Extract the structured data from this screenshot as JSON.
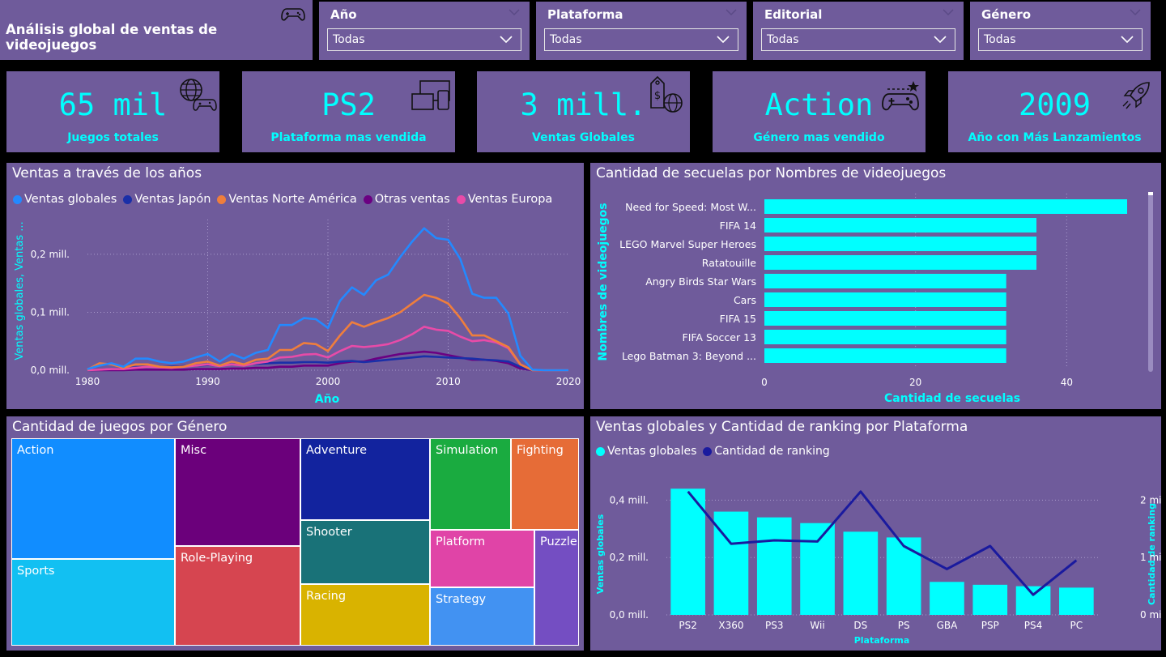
{
  "header": {
    "title": "Análisis global de ventas de videojuegos"
  },
  "slicers": [
    {
      "label": "Año",
      "value": "Todas"
    },
    {
      "label": "Plataforma",
      "value": "Todas"
    },
    {
      "label": "Editorial",
      "value": "Todas"
    },
    {
      "label": "Género",
      "value": "Todas"
    }
  ],
  "kpis": [
    {
      "value": "65 mil",
      "caption": "Juegos totales",
      "icon": "globe-gamepad-icon"
    },
    {
      "value": "PS2",
      "caption": "Plataforma mas vendida",
      "icon": "devices-icon"
    },
    {
      "value": "3 mill.",
      "caption": "Ventas Globales",
      "icon": "price-tag-globe-icon"
    },
    {
      "value": "Action",
      "caption": "Género mas vendido",
      "icon": "gamepad-star-icon"
    },
    {
      "value": "2009",
      "caption": "Año con Más Lanzamientos",
      "icon": "rocket-icon"
    }
  ],
  "colors": {
    "panel": "#6f5b9b",
    "accent": "#00ffff",
    "background": "#000000"
  },
  "chart_data": [
    {
      "type": "line",
      "title": "Ventas a través de los años",
      "xlabel": "Año",
      "ylabel": "Ventas globales, Ventas ...",
      "xlim": [
        1980,
        2020
      ],
      "ylim": [
        0,
        0.26
      ],
      "xticks": [
        "1980",
        "1990",
        "2000",
        "2010",
        "2020"
      ],
      "yticks": [
        {
          "v": 0,
          "label": "0,0 mill."
        },
        {
          "v": 0.1,
          "label": "0,1 mill."
        },
        {
          "v": 0.2,
          "label": "0,2 mill."
        }
      ],
      "x": [
        1980,
        1981,
        1982,
        1983,
        1984,
        1985,
        1986,
        1987,
        1988,
        1989,
        1990,
        1991,
        1992,
        1993,
        1994,
        1995,
        1996,
        1997,
        1998,
        1999,
        2000,
        2001,
        2002,
        2003,
        2004,
        2005,
        2006,
        2007,
        2008,
        2009,
        2010,
        2011,
        2012,
        2013,
        2014,
        2015,
        2016,
        2017,
        2018,
        2019,
        2020
      ],
      "series": [
        {
          "name": "Ventas globales",
          "color": "#2389ff",
          "values": [
            0.002,
            0.008,
            0.012,
            0.006,
            0.02,
            0.02,
            0.015,
            0.012,
            0.015,
            0.022,
            0.028,
            0.015,
            0.028,
            0.02,
            0.03,
            0.035,
            0.078,
            0.078,
            0.09,
            0.088,
            0.073,
            0.12,
            0.143,
            0.13,
            0.155,
            0.165,
            0.195,
            0.222,
            0.245,
            0.228,
            0.225,
            0.192,
            0.132,
            0.125,
            0.125,
            0.098,
            0.025,
            0.001,
            0,
            0,
            0
          ]
        },
        {
          "name": "Ventas Japón",
          "color": "#1a2fa8",
          "values": [
            0,
            0.001,
            0.002,
            0.003,
            0.005,
            0.006,
            0.006,
            0.006,
            0.007,
            0.008,
            0.009,
            0.008,
            0.01,
            0.01,
            0.011,
            0.012,
            0.013,
            0.013,
            0.014,
            0.014,
            0.013,
            0.015,
            0.016,
            0.014,
            0.016,
            0.018,
            0.02,
            0.022,
            0.024,
            0.023,
            0.022,
            0.021,
            0.02,
            0.018,
            0.017,
            0.015,
            0.006,
            0,
            0,
            0,
            0
          ]
        },
        {
          "name": "Ventas Norte América",
          "color": "#ef7e3c",
          "values": [
            0.001,
            0.012,
            0.01,
            0.004,
            0.01,
            0.01,
            0.006,
            0.005,
            0.006,
            0.012,
            0.015,
            0.008,
            0.015,
            0.01,
            0.018,
            0.02,
            0.035,
            0.035,
            0.047,
            0.045,
            0.033,
            0.06,
            0.083,
            0.075,
            0.083,
            0.09,
            0.1,
            0.115,
            0.13,
            0.125,
            0.115,
            0.09,
            0.06,
            0.06,
            0.05,
            0.04,
            0.01,
            0,
            0,
            0,
            0
          ]
        },
        {
          "name": "Otras ventas",
          "color": "#6b0082",
          "values": [
            0,
            0,
            0,
            0,
            0.001,
            0.001,
            0.001,
            0.001,
            0.001,
            0.002,
            0.002,
            0.002,
            0.003,
            0.003,
            0.004,
            0.004,
            0.006,
            0.006,
            0.008,
            0.008,
            0.008,
            0.012,
            0.015,
            0.015,
            0.02,
            0.024,
            0.028,
            0.03,
            0.032,
            0.03,
            0.026,
            0.022,
            0.018,
            0.018,
            0.016,
            0.012,
            0.003,
            0,
            0,
            0,
            0
          ]
        },
        {
          "name": "Ventas Europa",
          "color": "#e84ba8",
          "values": [
            0,
            0.001,
            0.002,
            0.002,
            0.004,
            0.006,
            0.005,
            0.004,
            0.006,
            0.008,
            0.01,
            0.007,
            0.01,
            0.008,
            0.012,
            0.015,
            0.022,
            0.023,
            0.027,
            0.028,
            0.022,
            0.033,
            0.042,
            0.04,
            0.042,
            0.045,
            0.052,
            0.062,
            0.075,
            0.07,
            0.068,
            0.058,
            0.05,
            0.052,
            0.048,
            0.038,
            0.01,
            0,
            0,
            0,
            0
          ]
        }
      ]
    },
    {
      "type": "bar",
      "orientation": "horizontal",
      "title": "Cantidad de secuelas por Nombres de videojuegos",
      "xlabel": "Cantidad de secuelas",
      "ylabel": "Nombres de videojuegos",
      "xlim": [
        0,
        48
      ],
      "xticks": [
        "0",
        "20",
        "40"
      ],
      "categories": [
        "Need for Speed: Most W...",
        "FIFA 14",
        "LEGO Marvel Super Heroes",
        "Ratatouille",
        "Angry Birds Star Wars",
        "Cars",
        "FIFA 15",
        "FIFA Soccer 13",
        "Lego Batman 3: Beyond ..."
      ],
      "values": [
        48,
        36,
        36,
        36,
        32,
        32,
        32,
        32,
        32
      ],
      "color": "#00ffff"
    },
    {
      "type": "treemap",
      "title": "Cantidad de juegos por Género",
      "categories": [
        "Action",
        "Sports",
        "Misc",
        "Role-Playing",
        "Adventure",
        "Shooter",
        "Racing",
        "Simulation",
        "Fighting",
        "Platform",
        "Puzzle",
        "Strategy"
      ],
      "colors": [
        "#118dff",
        "#12c0f2",
        "#6b007b",
        "#d64550",
        "#12239e",
        "#197278",
        "#d9b300",
        "#1aab40",
        "#e66c37",
        "#e044a7",
        "#744ec2",
        "#4292f2"
      ]
    },
    {
      "type": "bar+line",
      "title": "Ventas globales y Cantidad de ranking por Plataforma",
      "xlabel": "Plataforma",
      "ylabel": "Ventas globales",
      "y2label": "Cantidad de ranking",
      "categories": [
        "PS2",
        "X360",
        "PS3",
        "Wii",
        "DS",
        "PS",
        "GBA",
        "PSP",
        "PS4",
        "PC"
      ],
      "series": [
        {
          "name": "Ventas globales",
          "type": "bar",
          "color": "#00ffff",
          "values": [
            0.44,
            0.36,
            0.34,
            0.32,
            0.29,
            0.27,
            0.115,
            0.105,
            0.1,
            0.095
          ]
        },
        {
          "name": "Cantidad de ranking",
          "type": "line",
          "color": "#1a1a9e",
          "values": [
            2150,
            1240,
            1300,
            1280,
            2150,
            1200,
            800,
            1200,
            350,
            950
          ]
        }
      ],
      "ylim": [
        0,
        0.5
      ],
      "y2lim": [
        0,
        2500
      ],
      "yticks": [
        {
          "v": 0,
          "label": "0,0 mill."
        },
        {
          "v": 0.2,
          "label": "0,2 mill."
        },
        {
          "v": 0.4,
          "label": "0,4 mill."
        }
      ],
      "y2ticks": [
        {
          "v": 0,
          "label": "0 mil"
        },
        {
          "v": 1000,
          "label": "1 mil"
        },
        {
          "v": 2000,
          "label": "2 mil"
        }
      ]
    }
  ]
}
